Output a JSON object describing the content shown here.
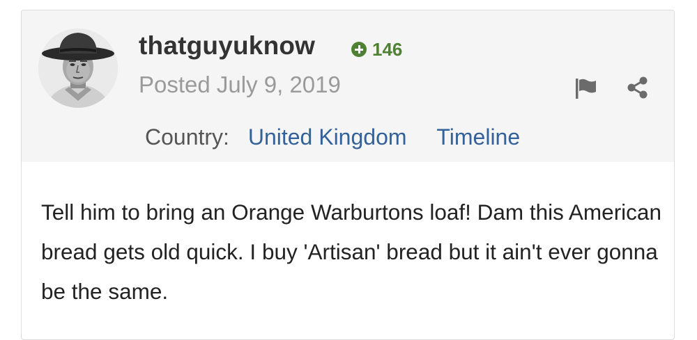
{
  "author": {
    "name": "thatguyuknow",
    "reputation": "146",
    "avatar_icon": "cowboy-portrait-avatar"
  },
  "post": {
    "posted_date": "Posted July 9, 2019",
    "body": "Tell him to bring an Orange Warburtons loaf! Dam this American bread gets old quick. I buy 'Artisan' bread but it ain't ever gonna be the same."
  },
  "meta": {
    "country_label": "Country:",
    "country_value": "United Kingdom",
    "timeline_label": "Timeline"
  },
  "actions": {
    "report_icon": "flag-icon",
    "share_icon": "share-icon"
  },
  "colors": {
    "reputation_green": "#4f8133",
    "link_blue": "#33619a",
    "header_bg": "#f5f5f5"
  }
}
